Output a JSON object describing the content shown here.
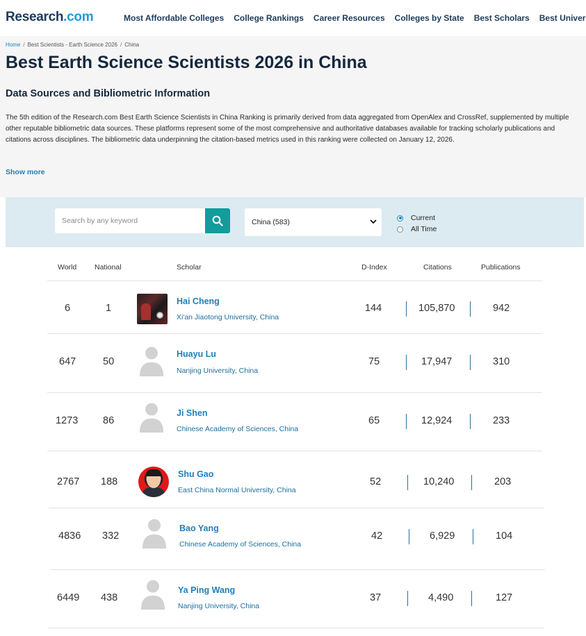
{
  "header": {
    "logo_main": "Research",
    "logo_dot": ".com",
    "nav": [
      "Most Affordable Colleges",
      "College Rankings",
      "Career Resources",
      "Colleges by State",
      "Best Scholars",
      "Best Universities"
    ]
  },
  "breadcrumb": [
    "Home",
    "Best Scientists - Earth Science 2026",
    "China"
  ],
  "page_title": "Best Earth Science Scientists 2026 in China",
  "section_title": "Data Sources and Bibliometric Information",
  "description": "The 5th edition of the Research.com Best Earth Science Scientists in China Ranking is primarily derived from data aggregated from OpenAlex and CrossRef, supplemented by multiple other reputable bibliometric data sources. These platforms represent some of the most comprehensive and authoritative databases available for tracking scholarly publications and citations across disciplines. The bibliometric data underpinning the citation-based metrics used in this ranking were collected on January 12, 2026.",
  "show_more": "Show more",
  "filters": {
    "search_placeholder": "Search by any keyword",
    "country_selected": "China (583)",
    "radio_current": "Current",
    "radio_all_time": "All Time"
  },
  "table": {
    "headers": {
      "world": "World",
      "national": "National",
      "scholar": "Scholar",
      "dindex": "D-Index",
      "citations": "Citations",
      "publications": "Publications"
    },
    "rows": [
      {
        "world": "6",
        "national": "1",
        "name": "Hai Cheng",
        "institution": "Xi'an Jiaotong University, China",
        "dindex": "144",
        "citations": "105,870",
        "publications": "942"
      },
      {
        "world": "647",
        "national": "50",
        "name": "Huayu Lu",
        "institution": "Nanjing University, China",
        "dindex": "75",
        "citations": "17,947",
        "publications": "310"
      },
      {
        "world": "1273",
        "national": "86",
        "name": "Ji Shen",
        "institution": "Chinese Academy of Sciences, China",
        "dindex": "65",
        "citations": "12,924",
        "publications": "233"
      },
      {
        "world": "2767",
        "national": "188",
        "name": "Shu Gao",
        "institution": "East China Normal University, China",
        "dindex": "52",
        "citations": "10,240",
        "publications": "203"
      },
      {
        "world": "4836",
        "national": "332",
        "name": "Bao Yang",
        "institution": "Chinese Academy of Sciences, China",
        "dindex": "42",
        "citations": "6,929",
        "publications": "104"
      },
      {
        "world": "6449",
        "national": "438",
        "name": "Ya Ping Wang",
        "institution": "Nanjing University, China",
        "dindex": "37",
        "citations": "4,490",
        "publications": "127"
      }
    ]
  }
}
